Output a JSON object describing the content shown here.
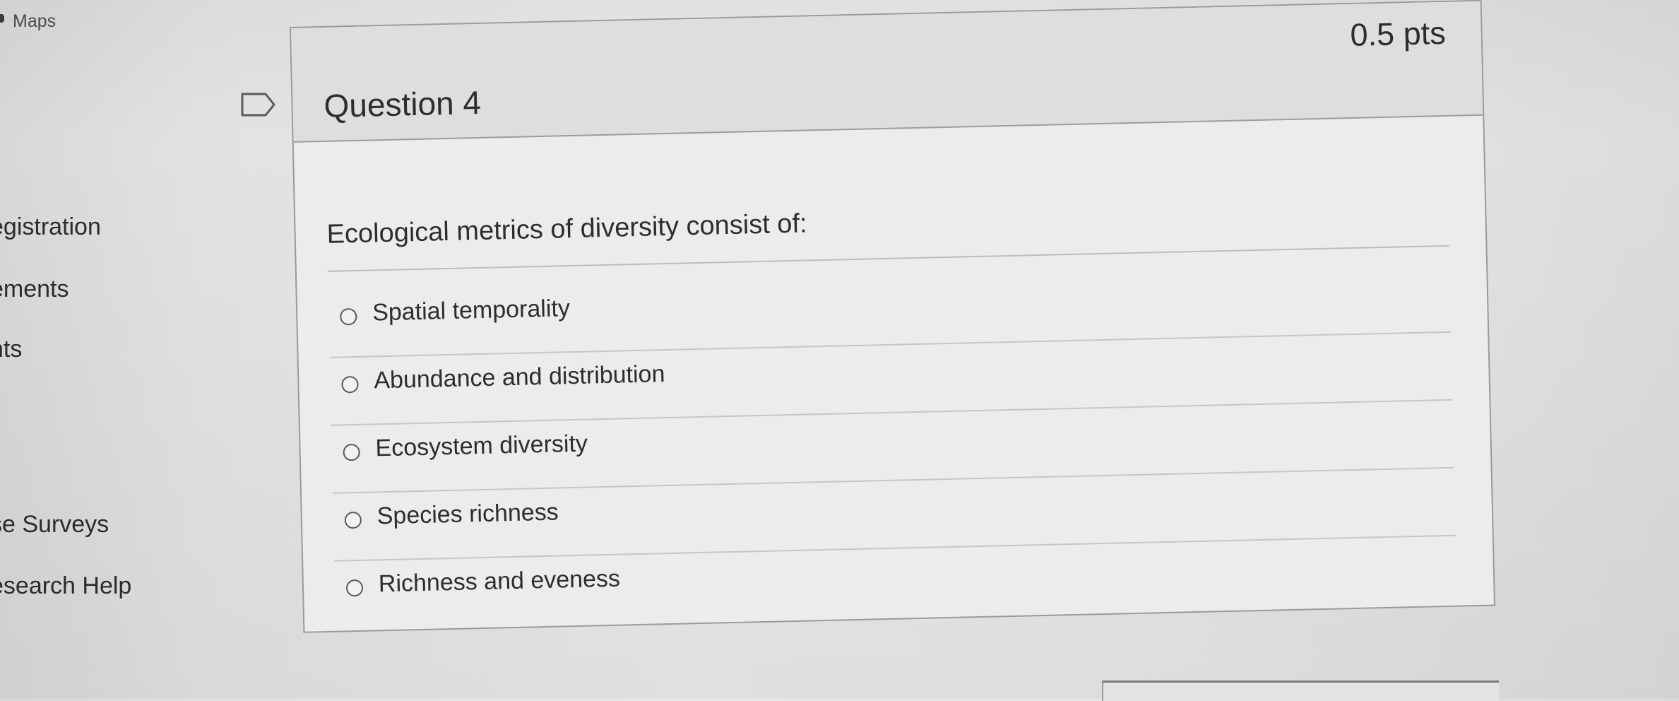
{
  "sidebar": {
    "maps_label": "Maps",
    "items": [
      {
        "label": "egistration"
      },
      {
        "label": "ements"
      },
      {
        "label": "nts"
      },
      {
        "label": "se Surveys"
      },
      {
        "label": "esearch Help"
      }
    ]
  },
  "question": {
    "title": "Question 4",
    "points": "0.5 pts",
    "text": "Ecological metrics of diversity consist of:",
    "answers": [
      {
        "label": "Spatial temporality",
        "selected": false
      },
      {
        "label": "Abundance and distribution",
        "selected": false
      },
      {
        "label": "Ecosystem diversity",
        "selected": false
      },
      {
        "label": "Species richness",
        "selected": false
      },
      {
        "label": "Richness and eveness",
        "selected": false
      }
    ]
  },
  "icons": {
    "flag": "flag-question-icon",
    "radio": "radio-button-icon"
  }
}
